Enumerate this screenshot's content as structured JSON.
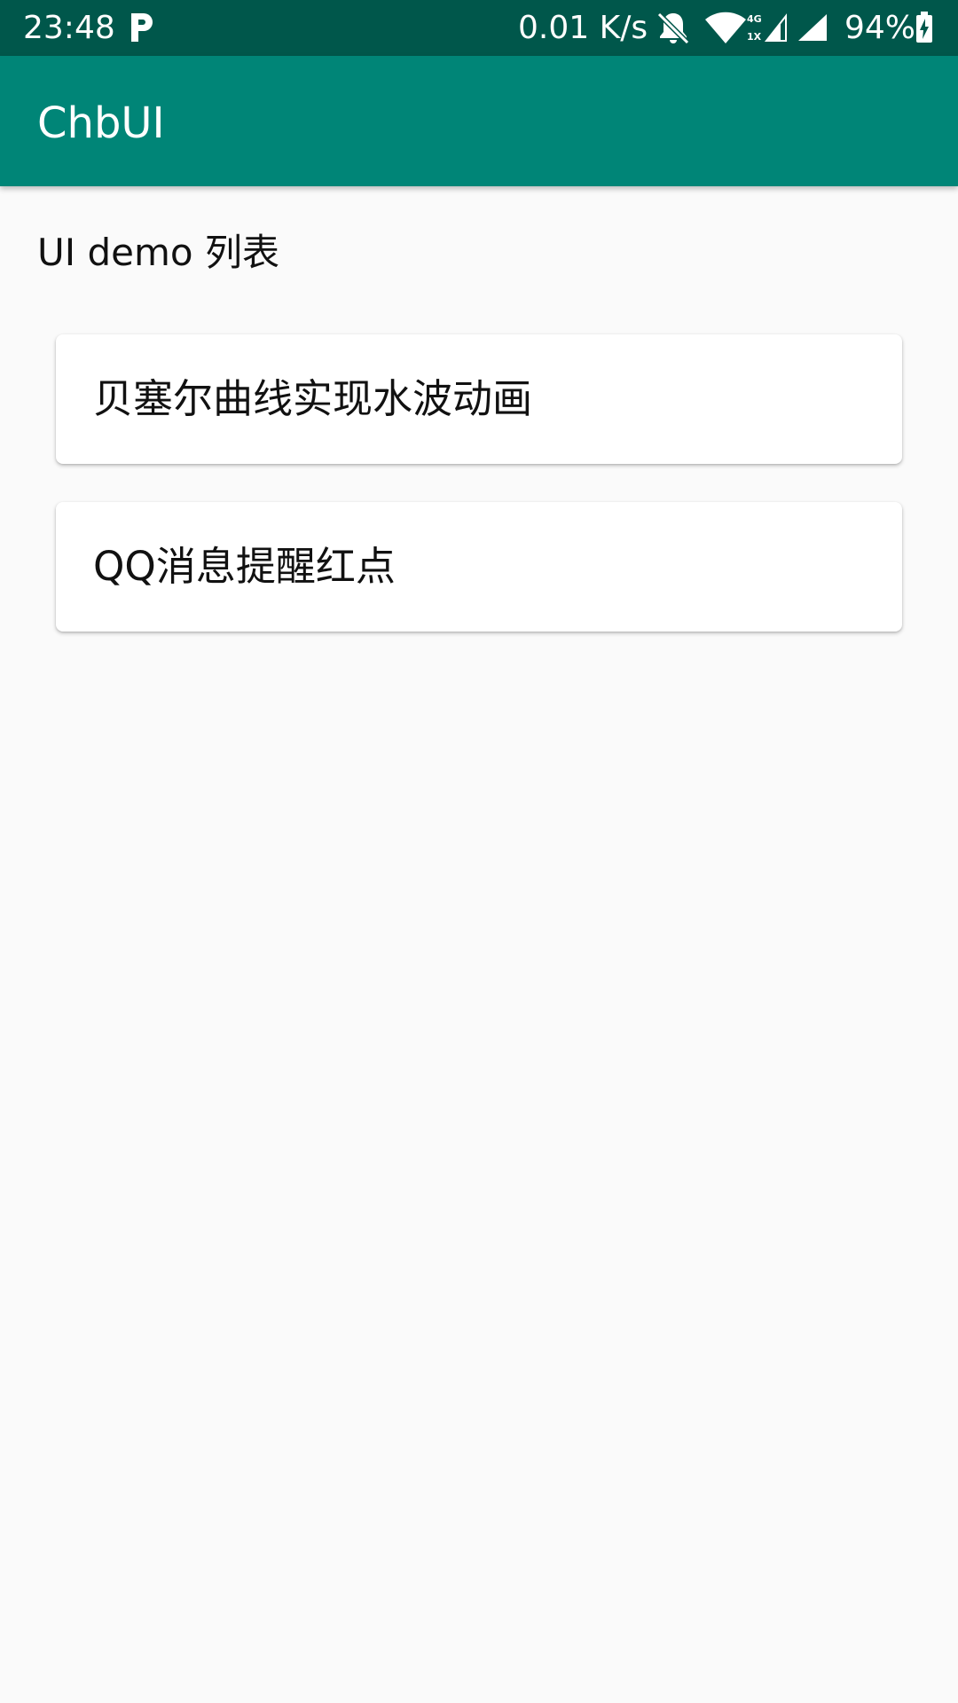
{
  "status_bar": {
    "time": "23:48",
    "net_speed": "0.01 K/s",
    "network_top": "4G",
    "network_bottom": "1X",
    "battery": "94%",
    "icons": [
      "p-icon",
      "bell-off-icon",
      "wifi-icon",
      "signal-icon",
      "signal-icon",
      "battery-charging-icon"
    ]
  },
  "app_bar": {
    "title": "ChbUI",
    "color": "#008577"
  },
  "main": {
    "section_label": "UI demo 列表",
    "items": [
      {
        "label": "贝塞尔曲线实现水波动画"
      },
      {
        "label": "QQ消息提醒红点"
      }
    ]
  }
}
